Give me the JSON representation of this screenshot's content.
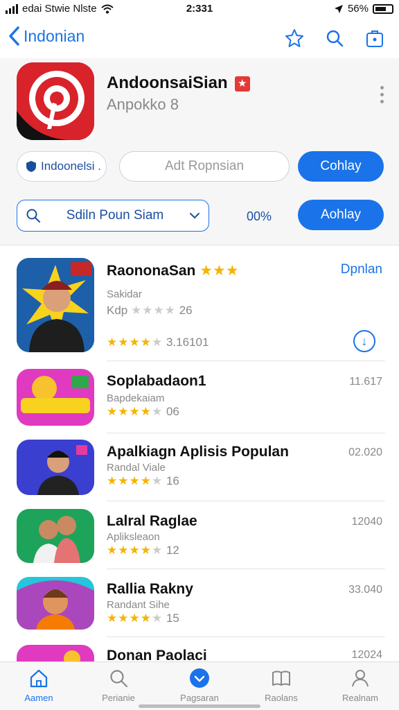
{
  "status": {
    "carrier": "edai Stwie Nlste",
    "time": "2:331",
    "battery": "56%"
  },
  "nav": {
    "back_label": "Indonian"
  },
  "header": {
    "title": "AndoonsaiSian",
    "subtitle": "Anpokko 8",
    "chip_label": "Indoonelsi .",
    "field_placeholder": "Adt Ropnsian",
    "primary_button": "Cohlay",
    "search_label": "Sdiln Poun Siam",
    "percent": "00%",
    "secondary_button": "Aohlay"
  },
  "featured": {
    "title": "RaononaSan",
    "subtitle": "Sakidar",
    "rating_text": "Kdp",
    "rating_count": "26",
    "stat": "3.16101",
    "action_label": "Dpnlan",
    "stars": 4
  },
  "apps": [
    {
      "title": "Soplabadaon1",
      "subtitle": "Bapdekaiam",
      "rating_count": "06",
      "side": "11.617",
      "stars": 4
    },
    {
      "title": "Apalkiagn Aplisis Populan",
      "subtitle": "Randal Viale",
      "rating_count": "16",
      "side": "02.020",
      "stars": 4
    },
    {
      "title": "Lalral Raglae",
      "subtitle": "Apliksleaon",
      "rating_count": "12",
      "side": "12040",
      "stars": 4
    },
    {
      "title": "Rallia Rakny",
      "subtitle": "Randant Sihe",
      "rating_count": "15",
      "side": "33.040",
      "stars": 4
    },
    {
      "title": "Donan Paolaci",
      "side": "12024"
    }
  ],
  "tabs": [
    {
      "label": "Aamen",
      "icon": "home-icon",
      "active": true
    },
    {
      "label": "Perianie",
      "icon": "search-icon"
    },
    {
      "label": "Pagsaran",
      "icon": "download-icon"
    },
    {
      "label": "Raolans",
      "icon": "book-icon"
    },
    {
      "label": "Realnam",
      "icon": "profile-icon"
    }
  ],
  "colors": {
    "accent": "#1a73e8",
    "star": "#f5b400",
    "brand_red": "#d8232a"
  }
}
